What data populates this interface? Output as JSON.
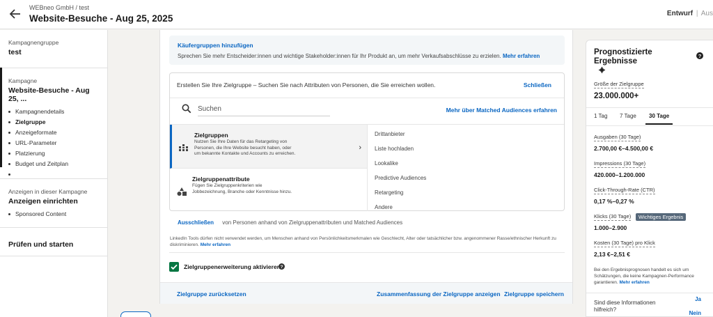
{
  "header": {
    "breadcrumb": "WEBneo GmbH / test",
    "title": "Website-Besuche - Aug 25, 2025",
    "status_active": "Entwurf",
    "status_separator": "|",
    "status_next": "Aus"
  },
  "sidebar": {
    "group_label": "Kampagnengruppe",
    "group_value": "test",
    "campaign_label": "Kampagne",
    "campaign_value": "Website-Besuche - Aug 25, ...",
    "steps": [
      "Kampagnendetails",
      "Zielgruppe",
      "Anzeigeformate",
      "URL-Parameter",
      "Platzierung",
      "Budget und Zeitplan",
      ""
    ],
    "current_step": "Zielgruppe",
    "ads_label": "Anzeigen in dieser Kampagne",
    "ads_value": "Anzeigen einrichten",
    "ads_items": [
      "Sponsored Content"
    ],
    "review": "Prüfen und starten"
  },
  "main": {
    "buyer_groups": {
      "title": "Käufergruppen hinzufügen",
      "text": "Sprechen Sie mehr Entscheider:innen und wichtige Stakeholder:innen für Ihr Produkt an, um mehr Verkaufsabschlüsse zu erzielen.",
      "link": "Mehr erfahren"
    },
    "builder": {
      "intro": "Erstellen Sie Ihre Zielgruppe – Suchen Sie nach Attributen von Personen, die Sie erreichen wollen.",
      "close": "Schließen",
      "search_placeholder": "Suchen",
      "matched_link": "Mehr über Matched Audiences erfahren",
      "categories": [
        {
          "name": "Zielgruppen",
          "desc": "Nutzen Sie Ihre Daten für das Retargeting von Personen, die Ihre Website besucht haben, oder um bekannte Kontakte und Accounts zu erreichen.",
          "icon": "audience-grid-icon"
        },
        {
          "name": "Zielgruppenattribute",
          "desc": "Fügen Sie Zielgruppenkriterien wie Jobbezeichnung, Branche oder Kenntnisse hinzu.",
          "icon": "shapes-icon"
        }
      ],
      "options": [
        "Drittanbieter",
        "Liste hochladen",
        "Lookalike",
        "Predictive Audiences",
        "Retargeting",
        "Andere"
      ]
    },
    "exclude": {
      "button": "Ausschließen",
      "text": "von Personen anhand von Zielgruppenattributen und Matched Audiences"
    },
    "legal": {
      "text": "LinkedIn Tools dürfen nicht verwendet werden, um Menschen anhand von Persönlichkeitsmerkmalen wie Geschlecht, Alter oder tatsächlicher bzw. angenommener Rasse/ethnischer Herkunft zu diskriminieren.",
      "link": "Mehr erfahren"
    },
    "expansion": {
      "label": "Zielgruppenerweiterung aktivieren",
      "checked": true
    },
    "footer": {
      "reset": "Zielgruppe zurücksetzen",
      "summary": "Zusammenfassung der Zielgruppe anzeigen",
      "save": "Zielgruppe speichern"
    }
  },
  "forecast": {
    "title": "Prognostizierte Ergebnisse",
    "audience_label": "Größe der Zielgruppe",
    "audience_value": "23.000.000+",
    "tabs": [
      "1 Tag",
      "7 Tage",
      "30 Tage"
    ],
    "active_tab": "30 Tage",
    "metrics": [
      {
        "label": "Ausgaben (30 Tage)",
        "value": "2.700,00 €–4.500,00 €"
      },
      {
        "label": "Impressions (30 Tage)",
        "value": "420.000–1.200.000"
      },
      {
        "label": "Click-Through-Rate (CTR)",
        "value": "0,17 %–0,27 %"
      },
      {
        "label": "Klicks (30 Tage)",
        "value": "1.000–2.900",
        "badge": "Wichtiges Ergebnis"
      },
      {
        "label": "Kosten (30 Tage) pro Klick",
        "value": "2,13 €–2,51 €"
      }
    ],
    "disclaimer": "Bei den Ergebnisprognosen handelt es sich um Schätzungen, die keine Kampagnen-Performance garantieren.",
    "disclaimer_link": "Mehr erfahren",
    "feedback_q": "Sind diese Informationen hilfreich?",
    "yes": "Ja",
    "no": "Nein"
  },
  "colors": {
    "link": "#0a66c2",
    "checkbox": "#057642",
    "badge": "#56687a"
  }
}
